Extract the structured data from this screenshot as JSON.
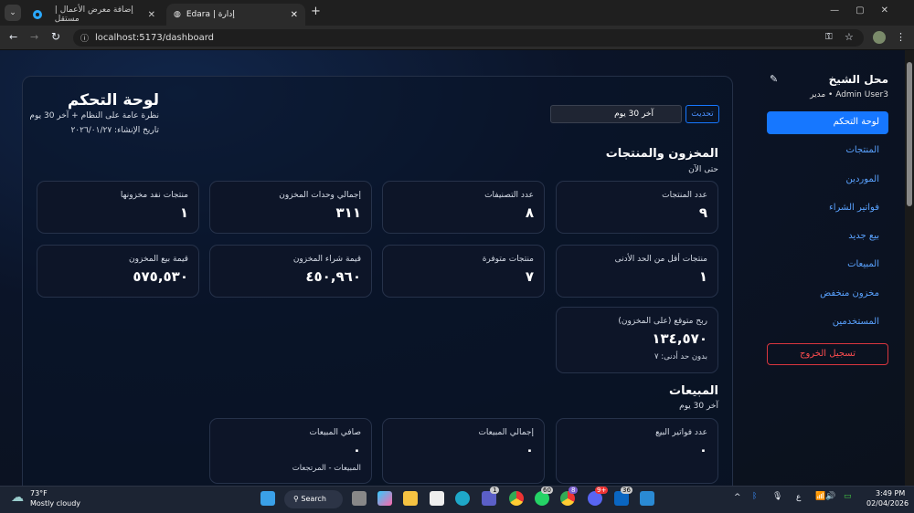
{
  "browser": {
    "tabs": [
      {
        "title": "إضافة معرض الأعمال | مستقل"
      },
      {
        "title": "Edara | إدارة"
      }
    ],
    "url": "localhost:5173/dashboard"
  },
  "sidebar": {
    "shop_name": "محل الشيخ",
    "user": "Admin User3 • مدير",
    "items": [
      {
        "label": "لوحة التحكم"
      },
      {
        "label": "المنتجات"
      },
      {
        "label": "الموردين"
      },
      {
        "label": "فواتير الشراء"
      },
      {
        "label": "بيع جديد"
      },
      {
        "label": "المبيعات"
      },
      {
        "label": "مخزون منخفض"
      },
      {
        "label": "المستخدمين"
      }
    ],
    "logout": "تسجيل الخروج"
  },
  "header": {
    "title": "لوحة التحكم",
    "subtitle": "نظرة عامة على النظام + آخر 30 يوم",
    "created": "تاريخ الإنشاء: ٢٠٢٦/٠١/٢٧",
    "refresh": "تحديث",
    "period": "آخر 30 يوم"
  },
  "inventory": {
    "title": "المخزون والمنتجات",
    "subtitle": "حتى الآن",
    "cards": [
      {
        "label": "عدد المنتجات",
        "value": "٩"
      },
      {
        "label": "عدد التصنيفات",
        "value": "٨"
      },
      {
        "label": "إجمالي وحدات المخزون",
        "value": "٣١١"
      },
      {
        "label": "منتجات نفد مخزونها",
        "value": "١"
      },
      {
        "label": "منتجات أقل من الحد الأدنى",
        "value": "١"
      },
      {
        "label": "منتجات متوفرة",
        "value": "٧"
      },
      {
        "label": "قيمة شراء المخزون",
        "value": "٤٥٠,٩٦٠"
      },
      {
        "label": "قيمة بيع المخزون",
        "value": "٥٧٥,٥٣٠"
      },
      {
        "label": "ربح متوقع (على المخزون)",
        "value": "١٣٤,٥٧٠",
        "sub": "بدون حد أدنى: ٧"
      }
    ]
  },
  "sales": {
    "title": "المبيعات",
    "subtitle": "آخر 30 يوم",
    "cards": [
      {
        "label": "عدد فواتير البيع",
        "value": "٠"
      },
      {
        "label": "إجمالي المبيعات",
        "value": "٠"
      },
      {
        "label": "صافي المبيعات",
        "value": "٠",
        "sub": "المبيعات - المرتجعات"
      }
    ]
  },
  "taskbar": {
    "weather_temp": "73°F",
    "weather_desc": "Mostly cloudy",
    "search": "Search",
    "time": "3:49 PM",
    "date": "02/04/2026",
    "lang": "ع",
    "badges": {
      "teams": "1",
      "whatsapp": "60",
      "chrome2": "8",
      "discord": "9+",
      "linkedin": "36"
    }
  }
}
